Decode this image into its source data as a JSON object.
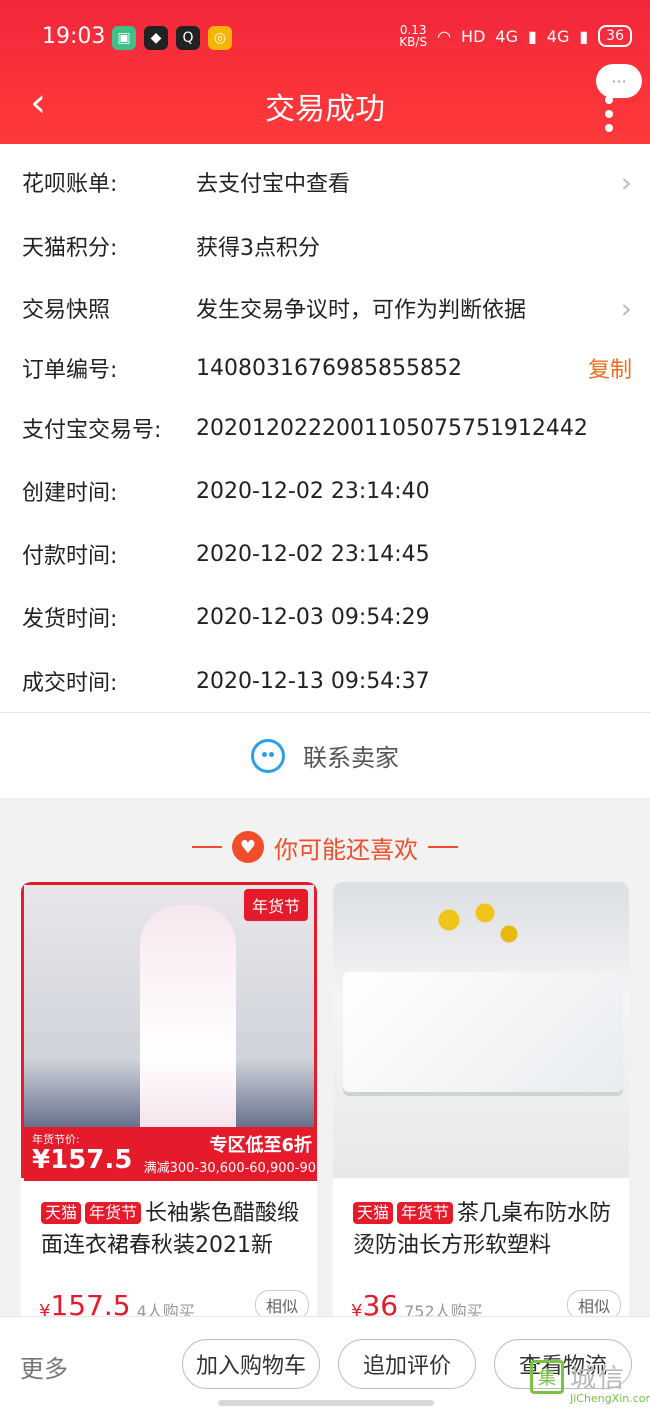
{
  "status_bar": {
    "time": "19:03",
    "net_speed_value": "0.13",
    "net_speed_unit": "KB/S",
    "hd": "HD",
    "signal1": "4G",
    "signal2": "4G",
    "battery": "36"
  },
  "nav": {
    "title": "交易成功",
    "back_glyph": "‹",
    "more_bubble": "···"
  },
  "info_rows": [
    {
      "label": "花呗账单:",
      "value": "去支付宝中查看"
    },
    {
      "label": "天猫积分:",
      "value": "获得3点积分"
    },
    {
      "label": "交易快照",
      "value": "发生交易争议时，可作为判断依据"
    },
    {
      "label": "订单编号:",
      "value": "1408031676985855852",
      "action": "复制"
    },
    {
      "label": "支付宝交易号:",
      "value": "2020120222001105075751912442"
    },
    {
      "label": "创建时间:",
      "value": "2020-12-02 23:14:40"
    },
    {
      "label": "付款时间:",
      "value": "2020-12-02 23:14:45"
    },
    {
      "label": "发货时间:",
      "value": "2020-12-03 09:54:29"
    },
    {
      "label": "成交时间:",
      "value": "2020-12-13 09:54:37"
    }
  ],
  "contact": {
    "label": "联系卖家"
  },
  "recommend": {
    "title": "你可能还喜欢"
  },
  "products": [
    {
      "tag1": "天猫",
      "tag2": "年货节",
      "title": "长袖紫色醋酸缎面连衣裙春秋装2021新",
      "badge": "年货节",
      "band_label": "年货节价:",
      "band_price": "¥157.5",
      "band_promo": "专区低至6折",
      "band_full": "满减300-30,600-60,900-90",
      "currency": "¥",
      "price": "157.5",
      "buyers": "4人购买",
      "similar": "相似"
    },
    {
      "tag1": "天猫",
      "tag2": "年货节",
      "title": "茶几桌布防水防烫防油长方形软塑料",
      "currency": "¥",
      "price": "36",
      "buyers": "752人购买",
      "similar": "相似"
    }
  ],
  "bottom_bar": {
    "more": "更多",
    "add_cart": "加入购物车",
    "add_review": "追加评价",
    "logistics": "查看物流"
  },
  "watermark": {
    "logo": "集",
    "cn": "城信",
    "en": "JiChengXin.com"
  },
  "colors": {
    "brand_red": "#e51b2c",
    "copy_orange": "#f46b1f",
    "contact_blue": "#2aa0ea"
  }
}
